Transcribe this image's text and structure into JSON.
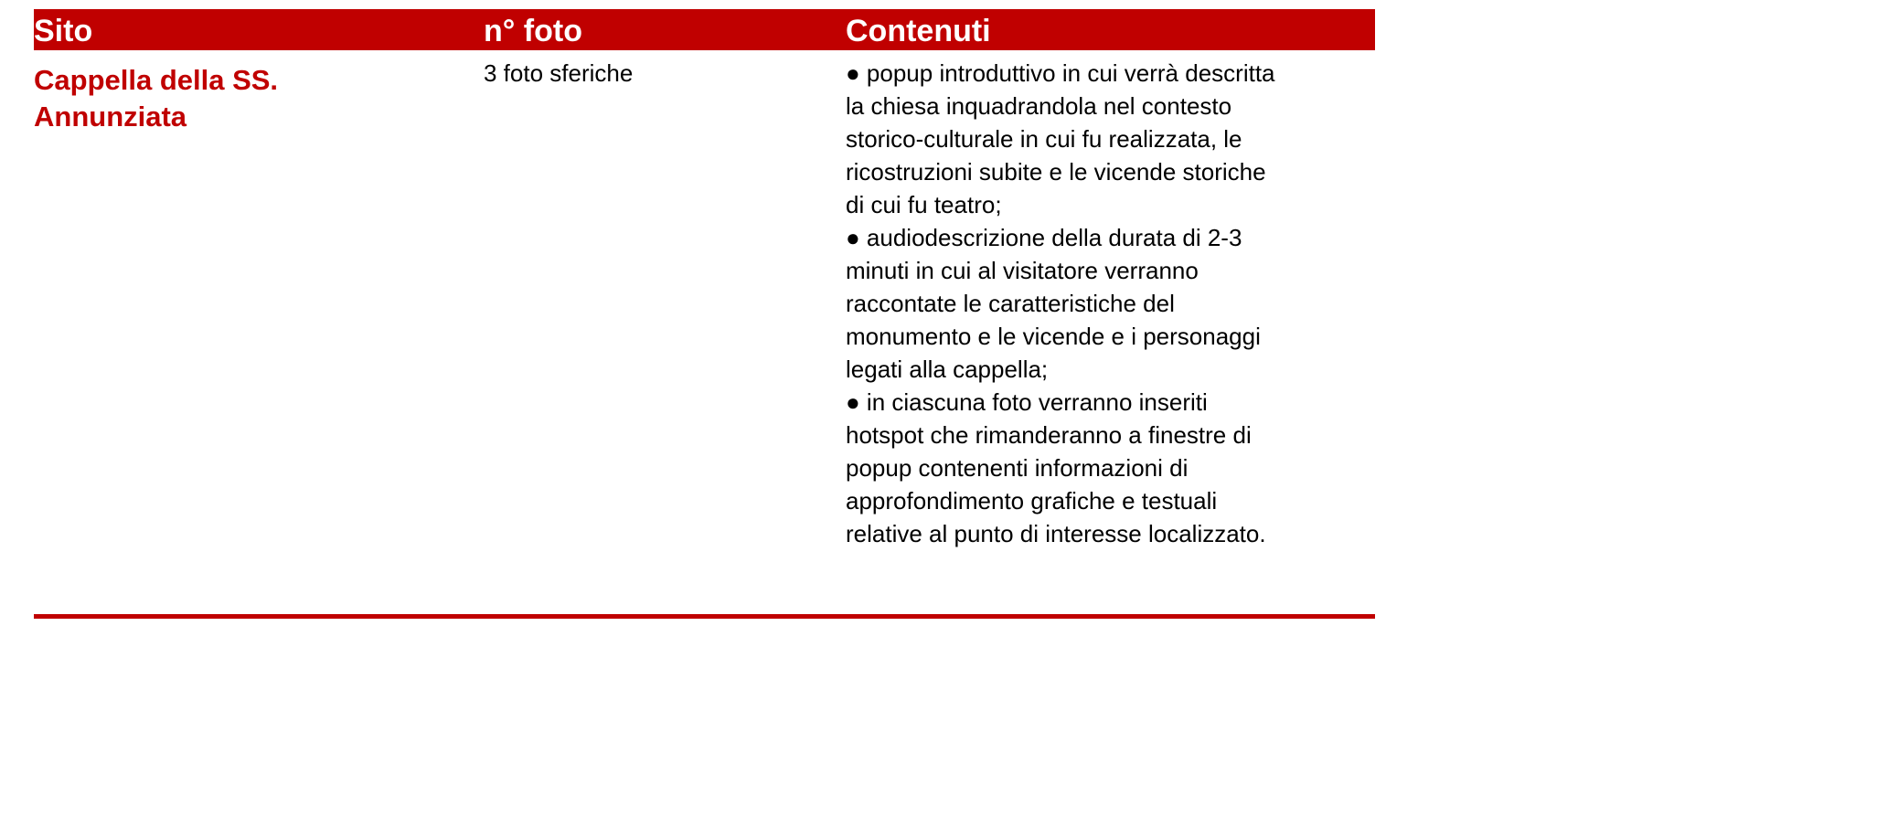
{
  "colors": {
    "accent": "#c00000",
    "header_text": "#ffffff",
    "body_text": "#000000"
  },
  "table": {
    "headers": {
      "site": "Sito",
      "count": "n° foto",
      "contents": "Contenuti"
    },
    "row": {
      "site_line1": "Cappella della SS.",
      "site_line2": "Annunziata",
      "count": "3 foto sferiche",
      "bullets": [
        "● popup introduttivo in cui verrà descritta\nla chiesa inquadrandola nel contesto\nstorico-culturale in cui fu realizzata, le\nricostruzioni subite e le vicende storiche\ndi cui fu teatro;",
        "● audiodescrizione della durata di 2-3\nminuti in cui al visitatore verranno\nraccontate le caratteristiche del\nmonumento e  le vicende e i personaggi\nlegati alla cappella;",
        "● in ciascuna foto verranno inseriti\nhotspot che rimanderanno a finestre di\npopup contenenti informazioni di\napprofondimento grafiche e testuali\nrelative al punto di interesse localizzato."
      ]
    }
  }
}
